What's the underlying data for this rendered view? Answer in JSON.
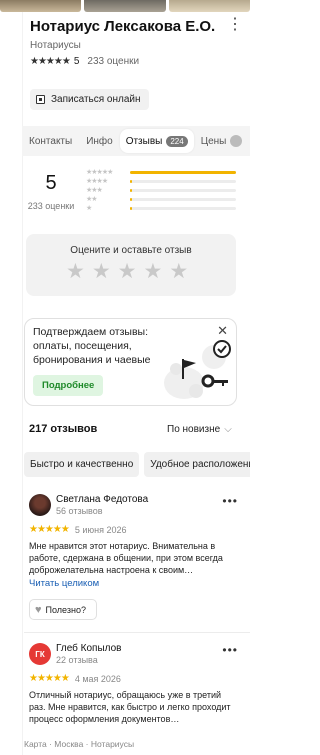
{
  "org": {
    "title": "Нотариус Лексакова Е.О.",
    "category": "Нотариусы",
    "rating_stars": "★★★★★",
    "rating_value": "5",
    "ratings_count": "233 оценки",
    "book_label": "Записаться онлайн"
  },
  "tabs": [
    {
      "label": "Контакты"
    },
    {
      "label": "Инфо"
    },
    {
      "label": "Отзывы",
      "badge": "224"
    },
    {
      "label": "Цены"
    }
  ],
  "summary": {
    "value": "5",
    "count": "233 оценки",
    "distribution": [
      {
        "stars": "★★★★★",
        "fraction": 1.0
      },
      {
        "stars": "★★★★",
        "fraction": 0.015
      },
      {
        "stars": "★★★",
        "fraction": 0.01
      },
      {
        "stars": "★★",
        "fraction": 0.008
      },
      {
        "stars": "★",
        "fraction": 0.012
      }
    ]
  },
  "rate_box": {
    "label": "Оцените и оставьте отзыв"
  },
  "promo": {
    "text": "Подтверждаем отзывы: оплаты, посещения, бронирования и чаевые",
    "button": "Подробнее"
  },
  "reviews_header": {
    "count": "217 отзывов",
    "sort": "По новизне"
  },
  "chips": [
    "Быстро и качественно",
    "Удобное расположение"
  ],
  "reviews": [
    {
      "author": "Светлана Федотова",
      "sub": "56 отзывов",
      "stars": "★★★★★",
      "date": "5 июня 2026",
      "text": "Мне нравится этот нотариус. Внимательна в работе, сдержана в общении, при этом всегда доброжелательна настроена к своим…",
      "read_more": "Читать целиком",
      "useful": "Полезно?"
    },
    {
      "author": "Глеб Копылов",
      "initials": "ГК",
      "sub": "22 отзыва",
      "stars": "★★★★★",
      "date": "4 мая 2026",
      "text": "Отличный нотариус, обращаюсь уже в третий раз. Мне нравится, как быстро и легко проходит процесс оформления документов…"
    }
  ],
  "footer": "Карта · Москва · Нотариусы",
  "colors": {
    "accent": "#f2b400",
    "link": "#1a5fb4",
    "promo_btn": "#1f8a2a"
  }
}
